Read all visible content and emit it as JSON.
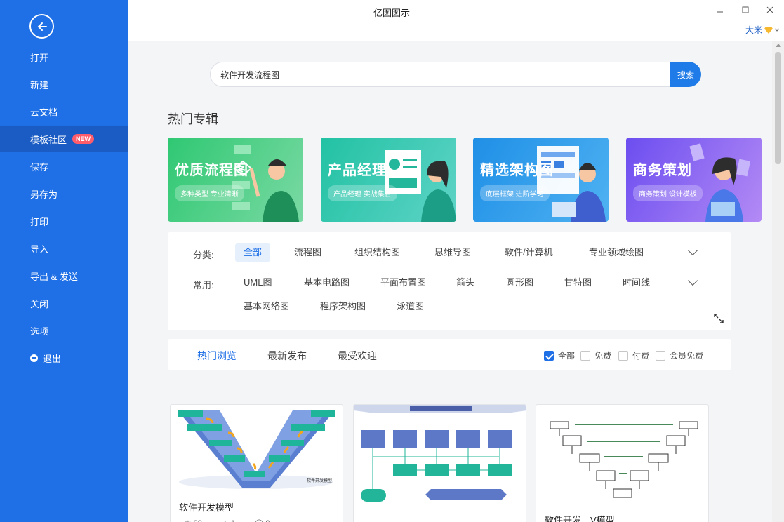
{
  "window": {
    "title": "亿图图示",
    "user": "大米"
  },
  "sidebar": {
    "items": [
      {
        "label": "打开"
      },
      {
        "label": "新建"
      },
      {
        "label": "云文档"
      },
      {
        "label": "模板社区",
        "badge": "NEW",
        "active": true
      },
      {
        "label": "保存"
      },
      {
        "label": "另存为"
      },
      {
        "label": "打印"
      },
      {
        "label": "导入"
      },
      {
        "label": "导出 & 发送"
      },
      {
        "label": "关闭"
      },
      {
        "label": "选项"
      },
      {
        "label": "退出"
      }
    ]
  },
  "search": {
    "value": "软件开发流程图",
    "button": "搜索"
  },
  "hot": {
    "title": "热门专辑",
    "banners": [
      {
        "title": "优质流程图",
        "sub": "多种类型 专业清晰",
        "color": "#3ec97a"
      },
      {
        "title": "产品经理",
        "sub": "产品经理 实战集合",
        "color": "#27c1a8"
      },
      {
        "title": "精选架构图",
        "sub": "底层框架 进阶学习",
        "color": "#2a9be8"
      },
      {
        "title": "商务策划",
        "sub": "商务策划 设计模板",
        "color": "#7b5cf0"
      }
    ]
  },
  "filters": {
    "category_label": "分类:",
    "categories": [
      "全部",
      "流程图",
      "组织结构图",
      "思维导图",
      "软件/计算机",
      "专业领域绘图"
    ],
    "common_label": "常用:",
    "common": [
      "UML图",
      "基本电路图",
      "平面布置图",
      "箭头",
      "圆形图",
      "甘特图",
      "时间线",
      "基本网络图",
      "程序架构图",
      "泳道图"
    ]
  },
  "sort": {
    "tabs": [
      "热门浏览",
      "最新发布",
      "最受欢迎"
    ],
    "checks": [
      {
        "label": "全部",
        "checked": true
      },
      {
        "label": "免费",
        "checked": false
      },
      {
        "label": "付费",
        "checked": false
      },
      {
        "label": "会员免费",
        "checked": false
      }
    ]
  },
  "cards": [
    {
      "name": "软件开发模型",
      "diagram_caption": "软件开发模型",
      "views": "80",
      "likes": "1",
      "comments": "8"
    },
    {
      "name": "",
      "views": "",
      "likes": "",
      "comments": ""
    },
    {
      "name": "软件开发—V模型",
      "views": "",
      "likes": "",
      "comments": ""
    }
  ]
}
